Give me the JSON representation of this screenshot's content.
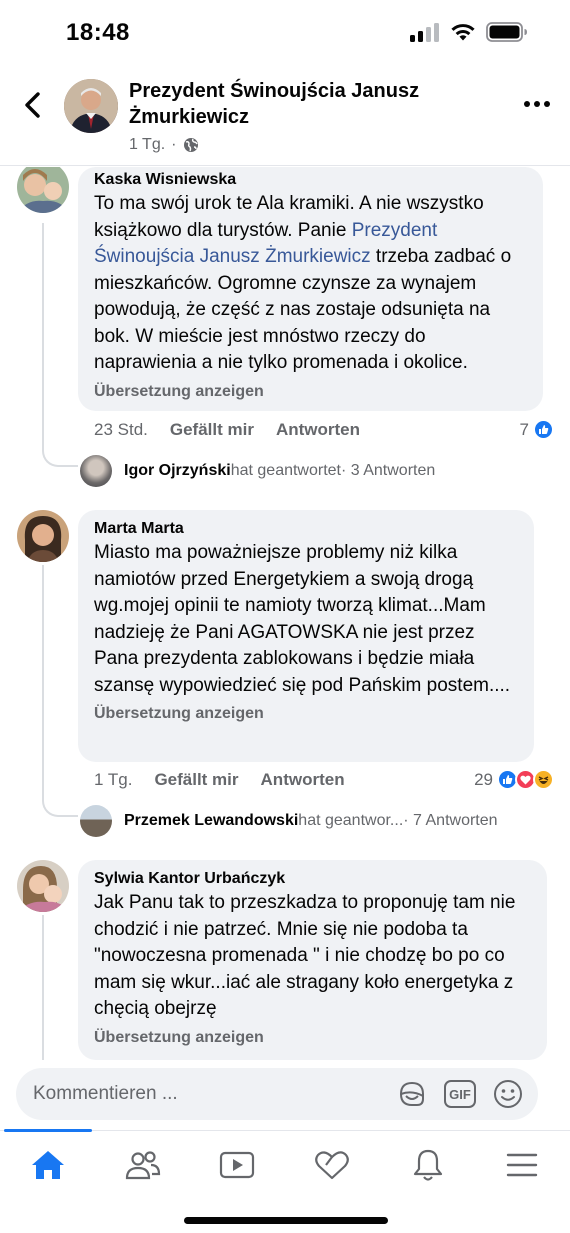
{
  "status_bar": {
    "time": "18:48"
  },
  "header": {
    "title": "Prezydent Świnoujścia Janusz Żmurkiewicz",
    "time": "1 Tg.",
    "separator": "·"
  },
  "comments": [
    {
      "author": "Kaska Wisniewska",
      "text_before": "To ma swój urok te Ala kramiki. A nie wszystko książkowo dla turystów. Panie ",
      "mention": "Prezydent Świnoujścia Janusz Żmurkiewicz",
      "text_after": " trzeba zadbać o mieszkańców. Ogromne czynsze za wynajem powodują, że część z nas zostaje odsunięta na bok. W mieście jest mnóstwo rzeczy do naprawienia a nie tylko promenada i okolice.",
      "translate": "Übersetzung anzeigen",
      "time": "23 Std.",
      "like_label": "Gefällt mir",
      "reply_label": "Antworten",
      "reaction_count": "7",
      "reply_preview": {
        "name": "Igor Ojrzyński",
        "verb": " hat geantwortet",
        "count": " · 3 Antworten"
      }
    },
    {
      "author": "Marta Marta",
      "text": "Miasto ma poważniejsze problemy niż kilka namiotów przed Energetykiem a swoją drogą wg.mojej opinii te namioty tworzą klimat...Mam nadzieję że Pani AGATOWSKA  nie jest przez Pana prezydenta zablokowans i będzie miała szansę wypowiedzieć się pod Pańskim postem....",
      "translate": "Übersetzung anzeigen",
      "time": "1 Tg.",
      "like_label": "Gefällt mir",
      "reply_label": "Antworten",
      "reaction_count": "29",
      "reply_preview": {
        "name": "Przemek Lewandowski",
        "verb": " hat geantwor...",
        "count": " · 7 Antworten"
      }
    },
    {
      "author": "Sylwia Kantor Urbańczyk",
      "text": "Jak Panu tak to przeszkadza to proponuję tam nie chodzić i nie patrzeć. Mnie się nie podoba ta \"nowoczesna promenada \" i nie chodzę bo po co mam się wkur...iać ale stragany koło energetyka z chęcią obejrzę",
      "translate": "Übersetzung anzeigen"
    }
  ],
  "composer": {
    "placeholder": "Kommentieren ...",
    "gif_label": "GIF"
  },
  "tabs": [
    "home-icon",
    "friends-icon",
    "watch-icon",
    "dating-icon",
    "notifications-icon",
    "menu-icon"
  ],
  "colors": {
    "accent": "#1877f2",
    "mention": "#385898",
    "bubble": "#f0f2f5",
    "muted": "#65676b"
  }
}
